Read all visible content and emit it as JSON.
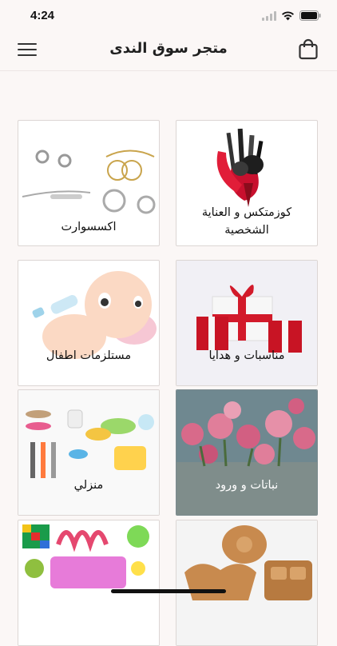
{
  "status": {
    "time": "4:24"
  },
  "header": {
    "title": "متجر سوق الندى"
  },
  "categories": [
    {
      "label": "كوزمتكس و العناية الشخصية"
    },
    {
      "label": "اكسسوارت"
    },
    {
      "label": "مناسبات و هدايا"
    },
    {
      "label": "مستلزمات اطفال"
    },
    {
      "label": "نباتات و ورود"
    },
    {
      "label": "منزلي"
    },
    {
      "label": ""
    },
    {
      "label": ""
    }
  ],
  "icons": {
    "menu": "hamburger-menu-icon",
    "cart": "shopping-bag-icon",
    "wifi": "wifi-icon",
    "battery": "battery-icon",
    "signal": "signal-icon"
  }
}
